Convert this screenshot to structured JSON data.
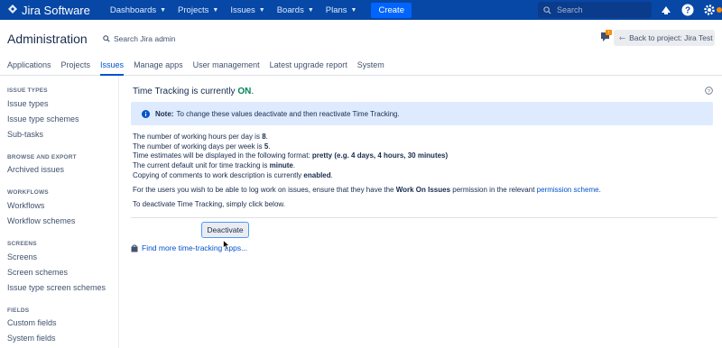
{
  "topnav": {
    "brand": "Jira Software",
    "items": [
      {
        "label": "Dashboards"
      },
      {
        "label": "Projects"
      },
      {
        "label": "Issues"
      },
      {
        "label": "Boards"
      },
      {
        "label": "Plans"
      }
    ],
    "create_label": "Create",
    "search_placeholder": "Search"
  },
  "header": {
    "title": "Administration",
    "search_label": "Search Jira admin",
    "back_label": "Back to project: Jira Test",
    "feedback_badge": "!"
  },
  "tabs": [
    {
      "label": "Applications"
    },
    {
      "label": "Projects"
    },
    {
      "label": "Issues"
    },
    {
      "label": "Manage apps"
    },
    {
      "label": "User management"
    },
    {
      "label": "Latest upgrade report"
    },
    {
      "label": "System"
    }
  ],
  "sidebar": {
    "sections": [
      {
        "heading": "ISSUE TYPES",
        "items": [
          "Issue types",
          "Issue type schemes",
          "Sub-tasks"
        ]
      },
      {
        "heading": "BROWSE AND EXPORT",
        "items": [
          "Archived issues"
        ]
      },
      {
        "heading": "WORKFLOWS",
        "items": [
          "Workflows",
          "Workflow schemes"
        ]
      },
      {
        "heading": "SCREENS",
        "items": [
          "Screens",
          "Screen schemes",
          "Issue type screen schemes"
        ]
      },
      {
        "heading": "FIELDS",
        "items": [
          "Custom fields",
          "System fields"
        ]
      }
    ]
  },
  "main": {
    "title_prefix": "Time Tracking is currently",
    "title_status": "ON",
    "title_suffix": ".",
    "note_label": "Note:",
    "note_text": "To change these values deactivate and then reactivate Time Tracking.",
    "line1_prefix": "The number of working hours per day is ",
    "line1_value": "8",
    "line1_suffix": ".",
    "line2_prefix": "The number of working days per week is ",
    "line2_value": "5",
    "line2_suffix": ".",
    "line3_prefix": "Time estimates will be displayed in the following format: ",
    "line3_value": "pretty (e.g. 4 days, 4 hours, 30 minutes)",
    "line4_prefix": "The current default unit for time tracking is ",
    "line4_value": "minute",
    "line4_suffix": ".",
    "line5_prefix": "Copying of comments to work description is currently ",
    "line5_value": "enabled",
    "line5_suffix": ".",
    "permission_prefix": "For the users you wish to be able to log work on issues, ensure that they have the ",
    "permission_bold": "Work On Issues",
    "permission_middle": " permission in the relevant ",
    "permission_link": "permission scheme",
    "permission_suffix": ".",
    "deactivate_hint": "To deactivate Time Tracking, simply click below.",
    "deactivate_label": "Deactivate",
    "find_apps_label": "Find more time-tracking apps..."
  },
  "colors": {
    "nav_bg": "#0747a6",
    "accent": "#0052cc",
    "on_green": "#00875a",
    "note_bg": "#deebff"
  }
}
